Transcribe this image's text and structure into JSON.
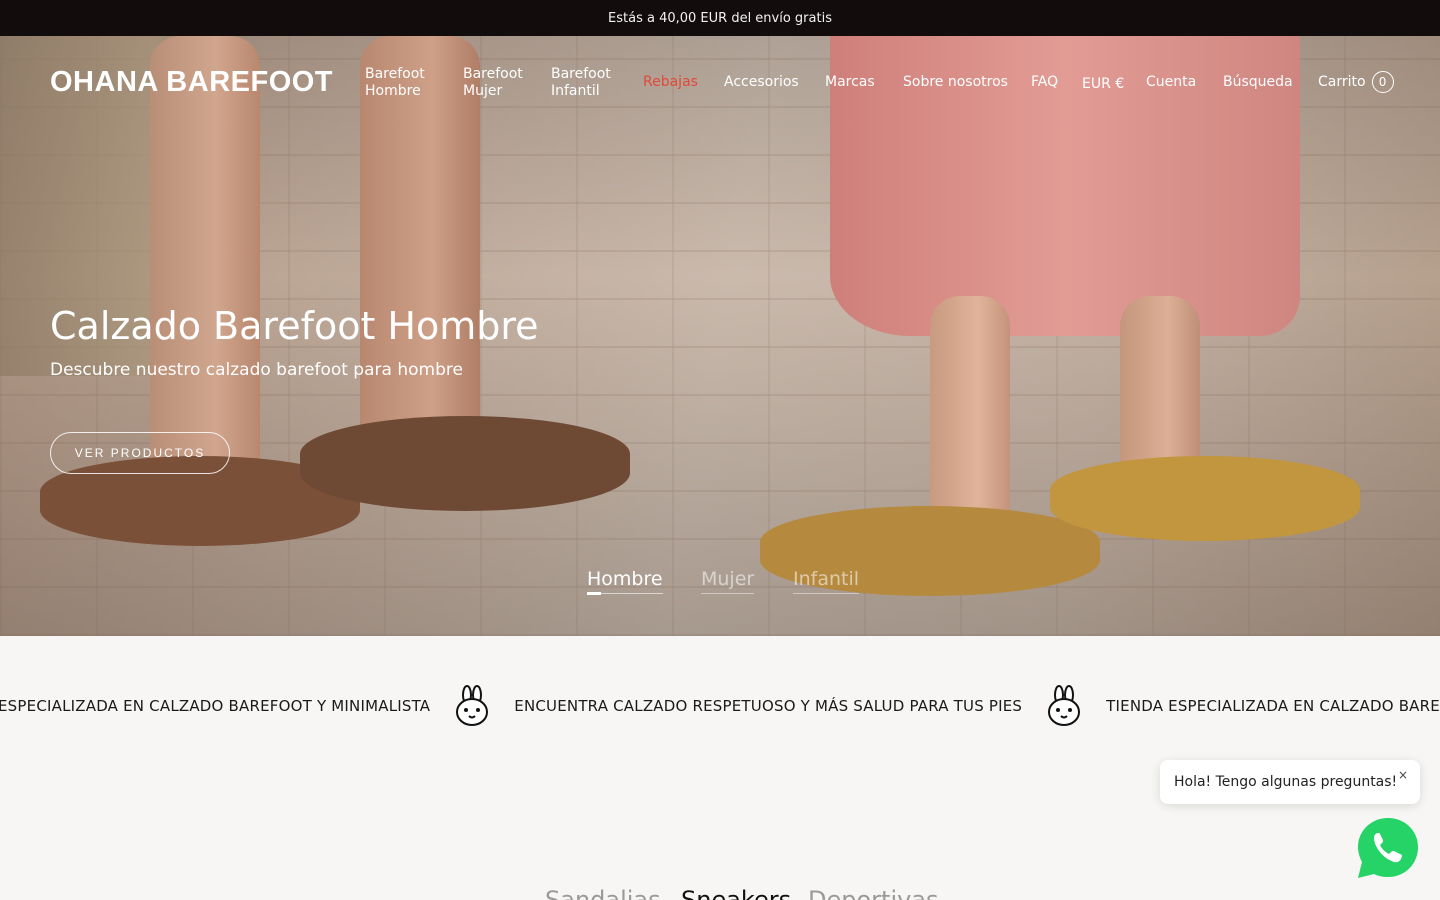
{
  "announcement": "Estás a 40,00 EUR del envío gratis",
  "header": {
    "logo": "OHANA BAREFOOT",
    "nav": {
      "hombre": "Barefoot\nHombre",
      "mujer": "Barefoot\nMujer",
      "infantil": "Barefoot\nInfantil",
      "rebajas": "Rebajas",
      "accesorios": "Accesorios",
      "marcas": "Marcas",
      "sobre": "Sobre nosotros",
      "faq": "FAQ",
      "currency": "EUR €",
      "cuenta": "Cuenta",
      "busqueda": "Búsqueda",
      "carrito": "Carrito",
      "cart_count": "0"
    },
    "sale_color": "#e04a3a"
  },
  "hero": {
    "title": "Calzado Barefoot Hombre",
    "subtitle": "Descubre nuestro calzado barefoot para hombre",
    "button": "VER PRODUCTOS",
    "tabs": [
      "Hombre",
      "Mujer",
      "Infantil"
    ],
    "active_tab": "Hombre"
  },
  "marquee": {
    "items": [
      "TIENDA ESPECIALIZADA EN CALZADO BAREFOOT Y MINIMALISTA",
      "ENCUENTRA CALZADO RESPETUOSO Y MÁS SALUD PARA TUS PIES",
      "TIENDA ESPECIALIZADA EN CALZADO BAREFOOT Y MINIMALISTA"
    ],
    "icon": "rabbit-icon"
  },
  "chat": {
    "message": "Hola! Tengo algunas preguntas!",
    "close": "×",
    "icon": "whatsapp-icon",
    "color": "#25d366"
  },
  "section_tabs": [
    "Sandalias",
    "Sneakers",
    "Deportivas"
  ]
}
